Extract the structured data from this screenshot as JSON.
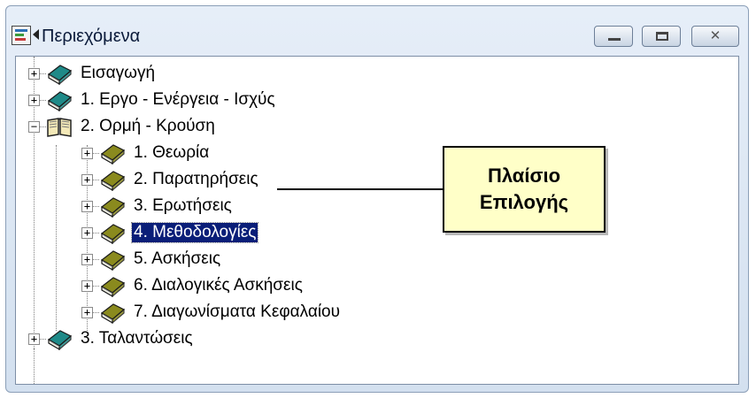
{
  "window": {
    "title": "Περιεχόμενα",
    "controls": {
      "minimize": "minimize",
      "maximize": "maximize",
      "close": "✕"
    }
  },
  "tree": {
    "items": [
      {
        "label": "Εισαγωγή",
        "level": 0,
        "expander": "+",
        "icon": "closed-book-teal-icon"
      },
      {
        "label": "1. Εργο - Ενέργεια - Ισχύς",
        "level": 0,
        "expander": "+",
        "icon": "closed-book-teal-icon"
      },
      {
        "label": "2. Ορμή - Κρούση",
        "level": 0,
        "expander": "−",
        "icon": "open-book-icon"
      },
      {
        "label": "1. Θεωρία",
        "level": 1,
        "expander": "+",
        "icon": "closed-book-olive-icon"
      },
      {
        "label": "2. Παρατηρήσεις",
        "level": 1,
        "expander": "+",
        "icon": "closed-book-olive-icon"
      },
      {
        "label": "3. Ερωτήσεις",
        "level": 1,
        "expander": "+",
        "icon": "closed-book-olive-icon"
      },
      {
        "label": "4. Μεθοδολογίες",
        "level": 1,
        "expander": "+",
        "icon": "closed-book-olive-icon",
        "selected": true
      },
      {
        "label": "5. Ασκήσεις",
        "level": 1,
        "expander": "+",
        "icon": "closed-book-olive-icon"
      },
      {
        "label": "6. Διαλογικές Ασκήσεις",
        "level": 1,
        "expander": "+",
        "icon": "closed-book-olive-icon"
      },
      {
        "label": "7. Διαγωνίσματα Κεφαλαίου",
        "level": 1,
        "expander": "+",
        "icon": "closed-book-olive-icon"
      },
      {
        "label": "3. Ταλαντώσεις",
        "level": 0,
        "expander": "+",
        "icon": "closed-book-teal-icon"
      }
    ]
  },
  "callout": {
    "text": "Πλαίσιο\nΕπιλογής"
  },
  "colors": {
    "selection": "#0a1e78",
    "callout_bg": "#ffffc8",
    "book_teal": "#1f8a88",
    "book_olive": "#8a8a1e"
  }
}
